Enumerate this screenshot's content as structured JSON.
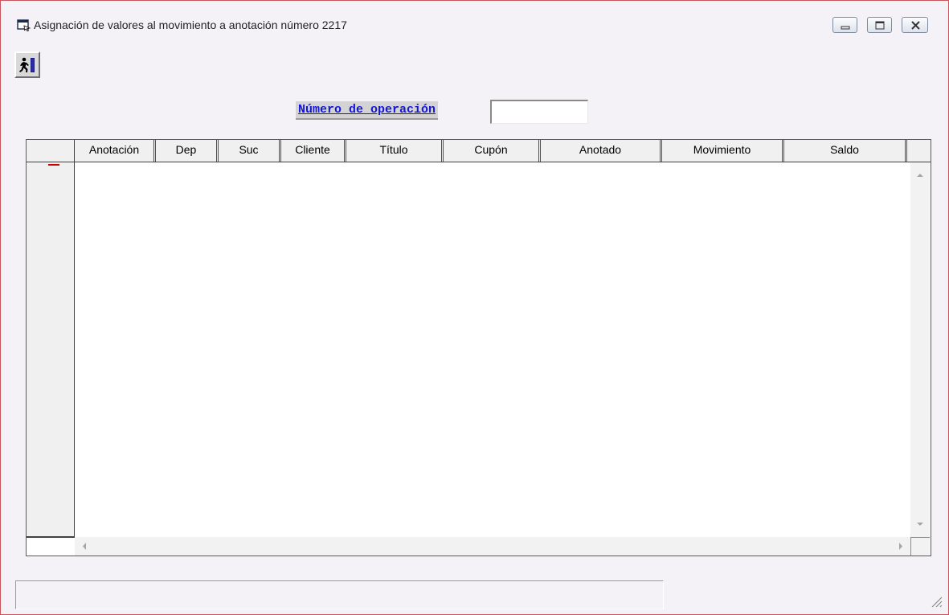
{
  "window": {
    "title": "Asignación de valores al movimiento a anotación número 2217",
    "icon": "window-app-icon",
    "controls": [
      "minimize-icon",
      "maximize-icon",
      "close-icon"
    ]
  },
  "toolbar": {
    "exit_icon": "exit-door-icon"
  },
  "operation": {
    "label": "Número de operación",
    "value": ""
  },
  "grid": {
    "columns": [
      "Anotación",
      "Dep",
      "Suc",
      "Cliente",
      "Título",
      "Cupón",
      "Anotado",
      "Movimiento",
      "Saldo"
    ],
    "rows": []
  },
  "status": {
    "text": ""
  },
  "colors": {
    "label_text": "#1515d8",
    "label_background": "#d3d3d3",
    "window_background": "#f4f2f6",
    "window_border": "#c9545c"
  }
}
